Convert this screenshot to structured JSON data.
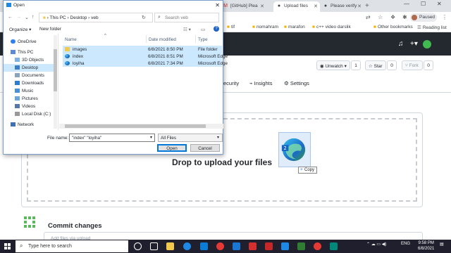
{
  "browser": {
    "tabs": [
      {
        "label": "[GitHub] Plea",
        "icon": "gmail-icon"
      },
      {
        "label": "Upload files",
        "icon": "github-icon"
      },
      {
        "label": "Please verify",
        "icon": "github-icon"
      }
    ],
    "profile_label": "Paused",
    "bookmarks": [
      "tif",
      "nomahram",
      "marafon",
      "c++ video darslik"
    ],
    "other_bookmarks": "Other bookmarks",
    "reading_list": "Reading list"
  },
  "repo": {
    "unwatch_label": "Unwatch",
    "unwatch_count": "1",
    "star_label": "Star",
    "star_count": "0",
    "fork_label": "Fork",
    "fork_count": "0",
    "tabs": [
      "Security",
      "Insights",
      "Settings"
    ]
  },
  "upload": {
    "drop_text": "Drop to upload your files",
    "copy_tooltip": "Copy",
    "commit_title": "Commit changes",
    "commit_placeholder": "Add files via upload"
  },
  "dialog": {
    "title": "Open",
    "breadcrumb": [
      "This PC",
      "Desktop",
      "veb"
    ],
    "search_placeholder": "Search veb",
    "organize_label": "Organize",
    "new_folder_label": "New folder",
    "nav_items": [
      {
        "label": "OneDrive",
        "icon": "cloud-icon"
      },
      {
        "label": "This PC",
        "icon": "computer-icon"
      },
      {
        "label": "3D Objects",
        "icon": "cube-icon"
      },
      {
        "label": "Desktop",
        "icon": "desktop-icon",
        "selected": true
      },
      {
        "label": "Documents",
        "icon": "document-icon"
      },
      {
        "label": "Downloads",
        "icon": "download-icon"
      },
      {
        "label": "Music",
        "icon": "music-icon"
      },
      {
        "label": "Pictures",
        "icon": "picture-icon"
      },
      {
        "label": "Videos",
        "icon": "video-icon"
      },
      {
        "label": "Local Disk (C:)",
        "icon": "disk-icon"
      },
      {
        "label": "Network",
        "icon": "network-icon"
      }
    ],
    "columns": [
      "Name",
      "Date modified",
      "Type"
    ],
    "files": [
      {
        "name": "images",
        "date": "6/8/2021 8:50 PM",
        "type": "File folder",
        "icon": "folder-icon"
      },
      {
        "name": "index",
        "date": "6/8/2021 8:51 PM",
        "type": "Microsoft Edge",
        "icon": "edge-icon"
      },
      {
        "name": "loyiha",
        "date": "6/8/2021 7:34 PM",
        "type": "Microsoft Edge",
        "icon": "edge-icon"
      }
    ],
    "file_name_label": "File name:",
    "file_name_value": "\"index\" \"loyiha\"",
    "file_type_value": "All Files",
    "open_label": "Open",
    "cancel_label": "Cancel"
  },
  "taskbar": {
    "search_placeholder": "Type here to search",
    "lang": "ENG",
    "time": "9:58 PM",
    "date": "6/8/2021"
  },
  "colors": {
    "gh_header": "#24292f",
    "selection": "#cce8ff",
    "accent": "#0078d7"
  }
}
